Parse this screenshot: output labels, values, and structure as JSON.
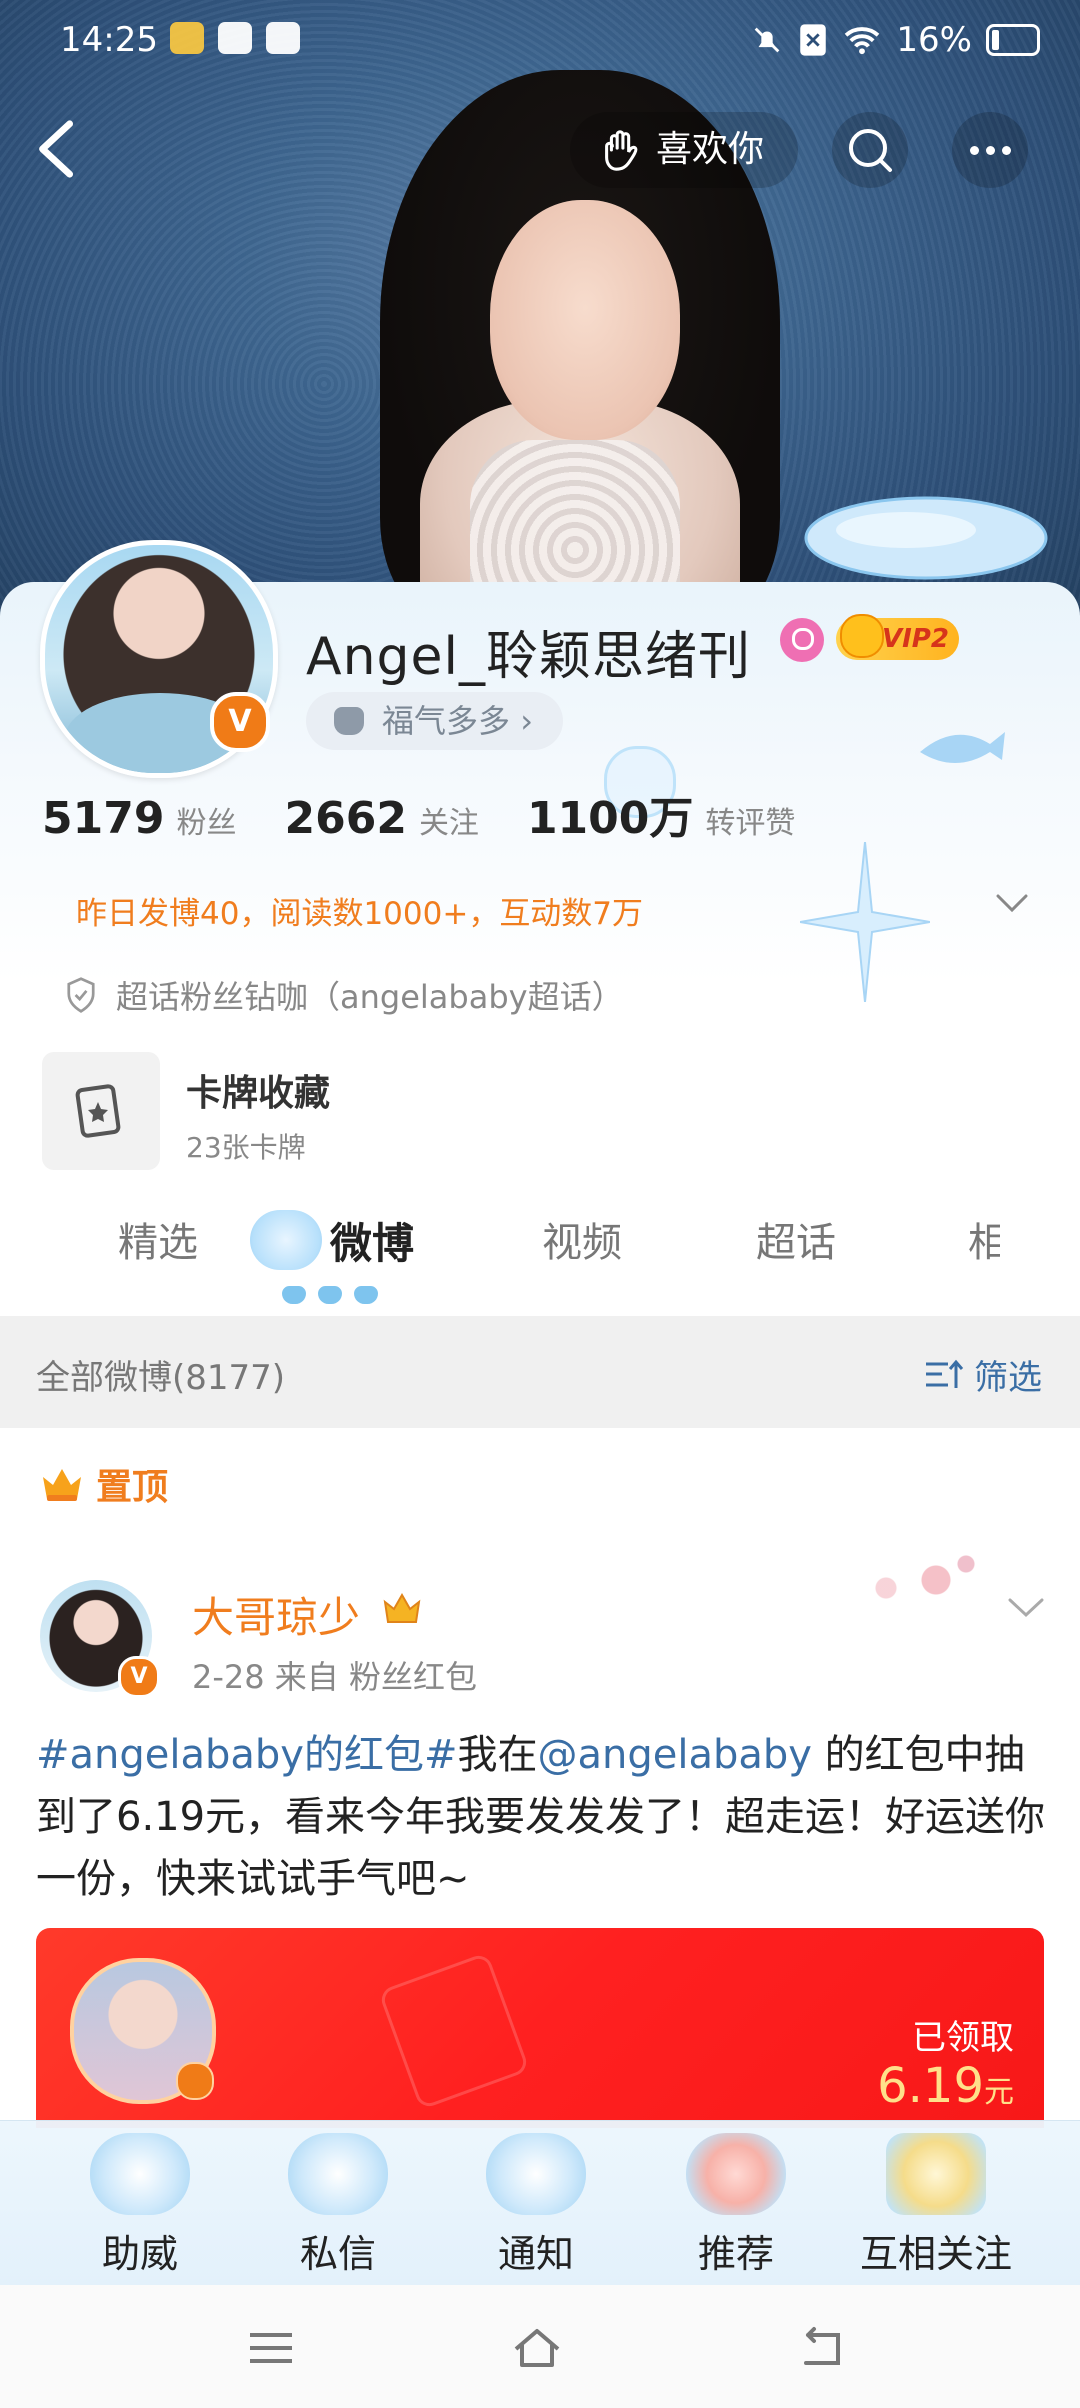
{
  "status_bar": {
    "time": "14:25",
    "battery": "16%",
    "icons": [
      "weibo-app-icon",
      "bot-icon",
      "notebook-icon",
      "mute-bell-icon",
      "sim-off-icon",
      "wifi-icon",
      "battery-icon"
    ]
  },
  "header": {
    "like_label": "喜欢你"
  },
  "profile": {
    "username": "Angel_聆颖思绪刊",
    "vip_label": "VIP2",
    "fuqi_label": "福气多多",
    "stats": [
      {
        "num": "5179",
        "label": "粉丝"
      },
      {
        "num": "2662",
        "label": "关注"
      },
      {
        "num": "1100万",
        "label": "转评赞"
      }
    ],
    "activity": "昨日发博40，阅读数1000+，互动数7万",
    "super_topic": "超话粉丝钻咖（angelababy超话）",
    "card_title": "卡牌收藏",
    "card_sub": "23张卡牌"
  },
  "tabs": [
    {
      "label": "精选",
      "active": false
    },
    {
      "label": "微博",
      "active": true
    },
    {
      "label": "视频",
      "active": false
    },
    {
      "label": "超话",
      "active": false
    },
    {
      "label": "相",
      "active": false
    }
  ],
  "filter": {
    "all_label": "全部微博(8177)",
    "filter_label": "筛选"
  },
  "post": {
    "pin_label": "置顶",
    "author": "大哥琼少",
    "meta": "2-28  来自 粉丝红包",
    "text_tag": "#angelababy的红包#",
    "text_mid": "我在",
    "text_mention": "@angelababy",
    "text_rest": " 的红包中抽到了6.19元，看来今年我要发发发了！超走运！好运送你一份，快来试试手气吧~",
    "redpack_status": "已领取",
    "redpack_amount": "6.19",
    "redpack_unit": "元"
  },
  "toolbar": {
    "items": [
      {
        "label": "助威"
      },
      {
        "label": "私信"
      },
      {
        "label": "通知"
      },
      {
        "label": "推荐"
      },
      {
        "label": "互相关注"
      }
    ]
  },
  "colors": {
    "orange": "#f07d1e",
    "link_blue": "#3a6ea5",
    "red_packet": "#ff2020"
  }
}
